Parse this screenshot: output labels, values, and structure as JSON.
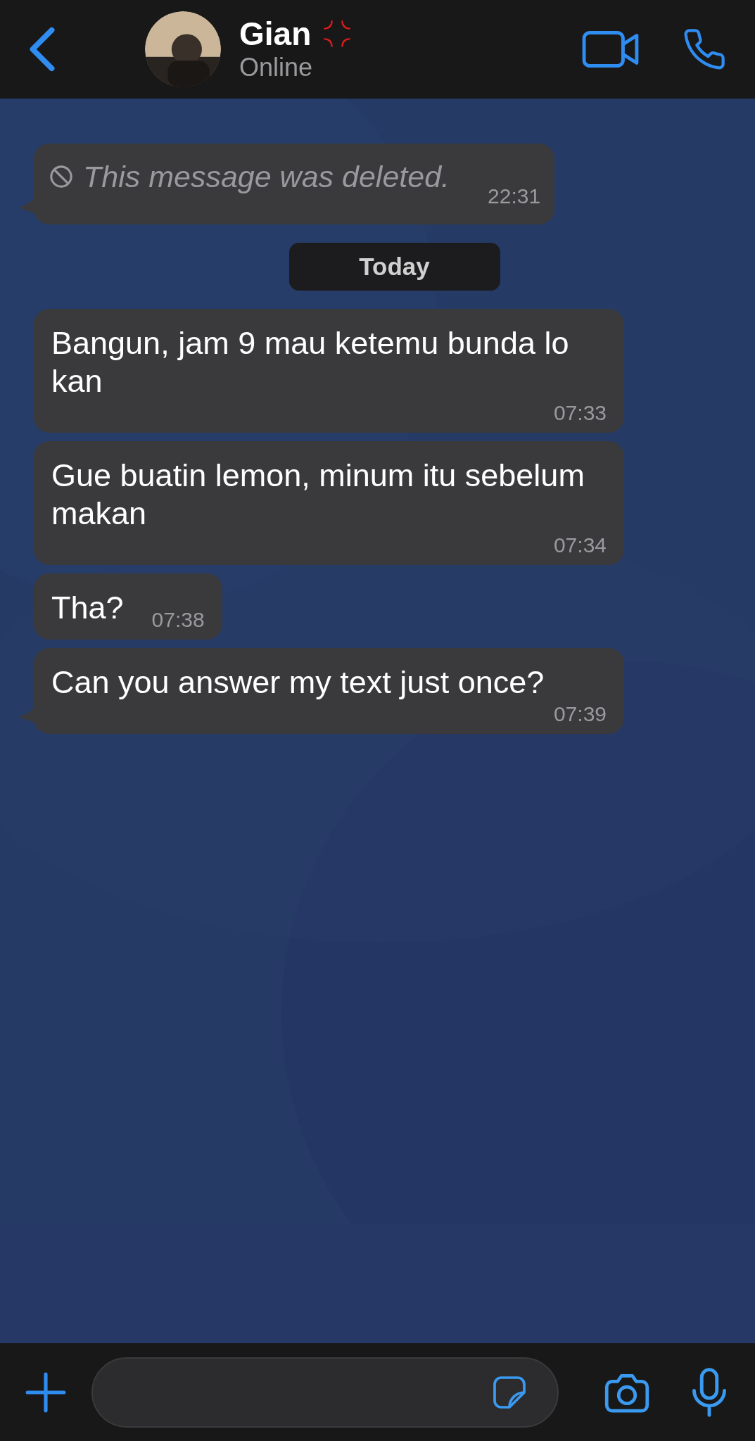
{
  "header": {
    "name": "Gian",
    "status": "Online"
  },
  "messages": [
    {
      "kind": "deleted",
      "text": "This message was deleted.",
      "time": "22:31",
      "tail": true
    },
    {
      "kind": "date",
      "text": "Today"
    },
    {
      "kind": "text",
      "text": "Bangun, jam 9 mau ketemu bunda lo kan",
      "time": "07:33",
      "tail": false
    },
    {
      "kind": "text",
      "text": "Gue buatin lemon, minum itu sebelum makan",
      "time": "07:34",
      "tail": false
    },
    {
      "kind": "text",
      "text": "Tha?",
      "time": "07:38",
      "tail": false
    },
    {
      "kind": "text",
      "text": "Can you answer my text just once?",
      "time": "07:39",
      "tail": true
    }
  ]
}
